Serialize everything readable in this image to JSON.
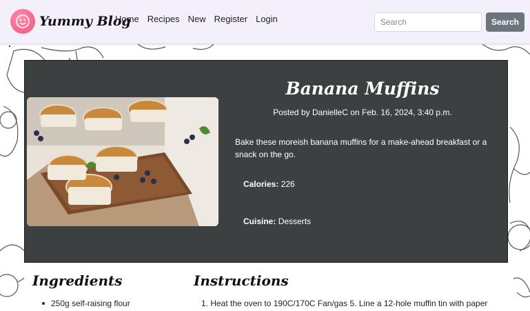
{
  "navbar": {
    "brand": "Yummy Blog",
    "links": [
      "Home",
      "Recipes",
      "New",
      "Register",
      "Login"
    ],
    "search_placeholder": "Search",
    "search_button": "Search"
  },
  "recipe": {
    "title": "Banana Muffins",
    "posted_by": "Posted by DanielleC on Feb. 16, 2024, 3:40 p.m.",
    "description": "Bake these moreish banana muffins for a make-ahead breakfast or a snack on the go.",
    "calories_label": "Calories:",
    "calories_value": "226",
    "cuisine_label": "Cuisine:",
    "cuisine_value": "Desserts"
  },
  "ingredients": {
    "heading": "Ingredients",
    "items": [
      "250g self-raising flour"
    ]
  },
  "instructions": {
    "heading": "Instructions",
    "items": [
      "1. Heat the oven to 190C/170C Fan/gas 5. Line a 12-hole muffin tin with paper"
    ]
  },
  "colors": {
    "navbar_bg": "#f3f0fb",
    "hero_bg": "#3c4041",
    "search_button_bg": "#6c757d",
    "logo_pink": "#f0507a"
  },
  "icons": {
    "logo": "smiley-face-icon"
  }
}
